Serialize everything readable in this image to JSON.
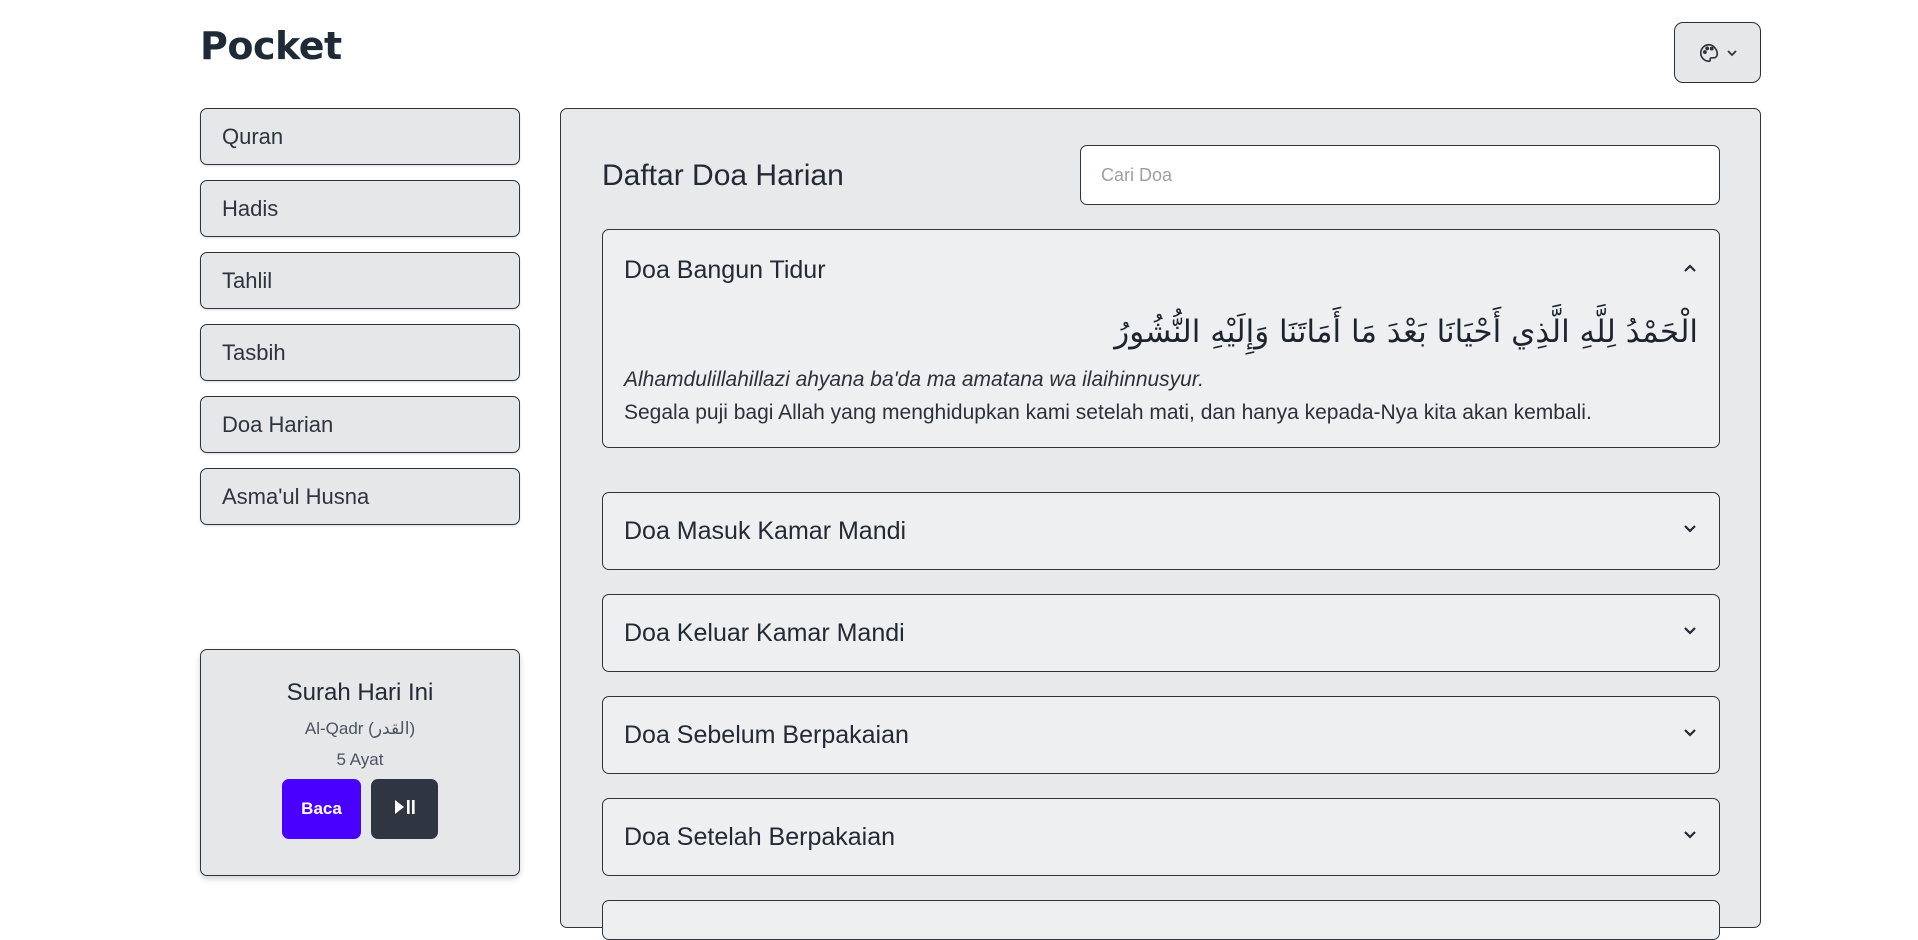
{
  "app": {
    "title": "Pocket"
  },
  "theme_button": {
    "icon": "palette-icon",
    "caret": "chevron-down-icon"
  },
  "sidebar": {
    "items": [
      {
        "label": "Quran"
      },
      {
        "label": "Hadis"
      },
      {
        "label": "Tahlil"
      },
      {
        "label": "Tasbih"
      },
      {
        "label": "Doa Harian"
      },
      {
        "label": "Asma'ul Husna"
      }
    ]
  },
  "surah_card": {
    "heading": "Surah Hari Ini",
    "name": "Al-Qadr (القدر)",
    "ayat": "5 Ayat",
    "read_label": "Baca",
    "play_icon": "play-pause-icon",
    "read_color": "#4a00ff"
  },
  "main": {
    "title": "Daftar Doa Harian",
    "search": {
      "placeholder": "Cari Doa",
      "value": ""
    },
    "doa": [
      {
        "title": "Doa Bangun Tidur",
        "expanded": true,
        "arabic": "الْحَمْدُ لِلَّهِ الَّذِي أَحْيَانَا بَعْدَ مَا أَمَاتَنَا وَإِلَيْهِ النُّشُورُ",
        "latin": "Alhamdulillahillazi ahyana ba'da ma amatana wa ilaihinnusyur.",
        "meaning": "Segala puji bagi Allah yang menghidupkan kami setelah mati, dan hanya kepada-Nya kita akan kembali."
      },
      {
        "title": "Doa Masuk Kamar Mandi",
        "expanded": false
      },
      {
        "title": "Doa Keluar Kamar Mandi",
        "expanded": false
      },
      {
        "title": "Doa Sebelum Berpakaian",
        "expanded": false
      },
      {
        "title": "Doa Setelah Berpakaian",
        "expanded": false
      }
    ]
  }
}
